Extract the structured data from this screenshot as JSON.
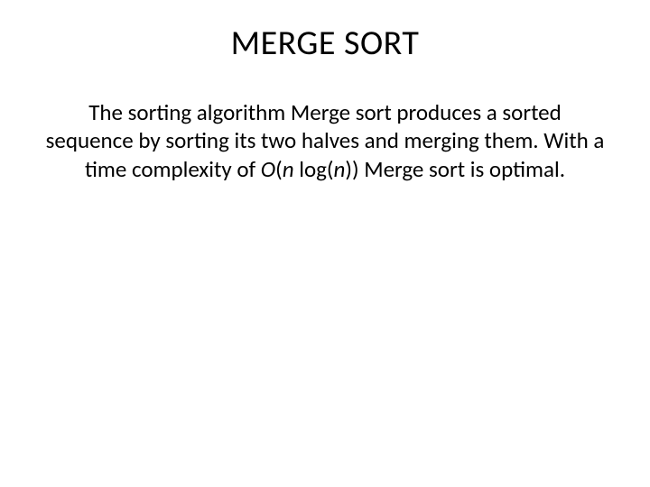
{
  "slide": {
    "title": "MERGE SORT",
    "text_part1": "The sorting algorithm Merge sort produces a sorted sequence by sorting its two halves and merging them. With a time complexity of ",
    "text_italic1": "O",
    "text_part2": "(",
    "text_italic2": "n",
    "text_part3": " log(",
    "text_italic3": "n",
    "text_part4": ")) Merge sort is optimal."
  }
}
